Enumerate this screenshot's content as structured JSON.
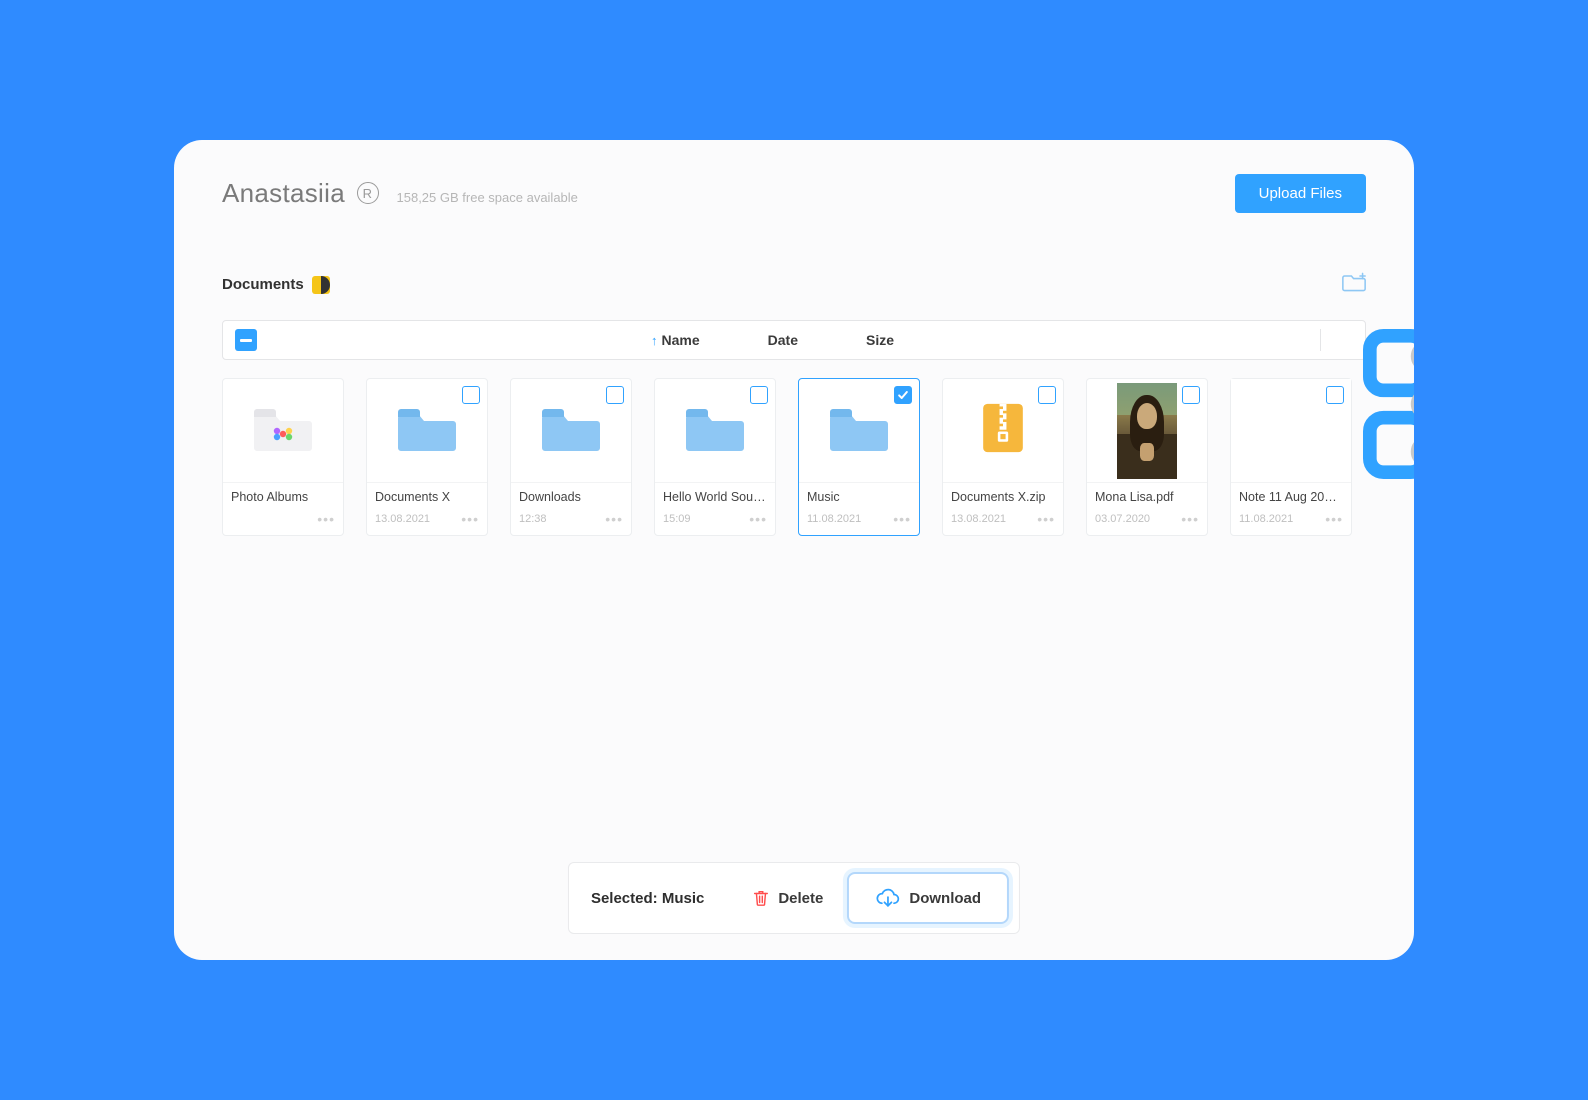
{
  "header": {
    "user_name": "Anastasiia",
    "badge_letter": "R",
    "free_space": "158,25 GB free space available",
    "upload_label": "Upload Files"
  },
  "breadcrumb": {
    "label": "Documents"
  },
  "sort": {
    "name": "Name",
    "date": "Date",
    "size": "Size"
  },
  "selection": {
    "prefix": "Selected:",
    "item": "Music",
    "delete": "Delete",
    "download": "Download"
  },
  "files": [
    {
      "name": "Photo Albums",
      "date": "",
      "icon": "photos",
      "selected": false,
      "nocheck": true
    },
    {
      "name": "Documents X",
      "date": "13.08.2021",
      "icon": "folder",
      "selected": false
    },
    {
      "name": "Downloads",
      "date": "12:38",
      "icon": "folder",
      "selected": false
    },
    {
      "name": "Hello World Sour…",
      "date": "15:09",
      "icon": "folder",
      "selected": false
    },
    {
      "name": "Music",
      "date": "11.08.2021",
      "icon": "folder",
      "selected": true
    },
    {
      "name": "Documents X.zip",
      "date": "13.08.2021",
      "icon": "zip",
      "selected": false
    },
    {
      "name": "Mona Lisa.pdf",
      "date": "03.07.2020",
      "icon": "mona",
      "selected": false
    },
    {
      "name": "Note 11 Aug 202…",
      "date": "11.08.2021",
      "icon": "blank",
      "selected": false
    }
  ]
}
